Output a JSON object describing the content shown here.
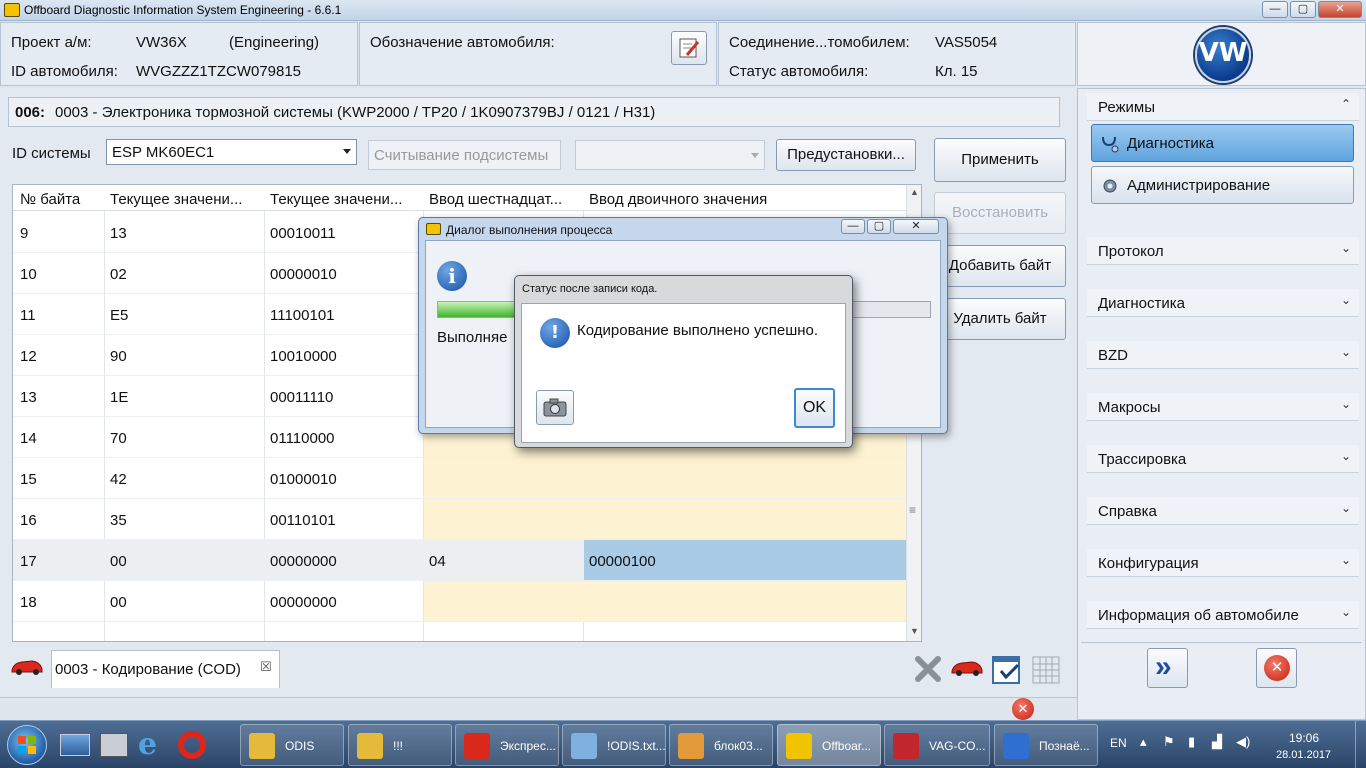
{
  "window": {
    "title": "Offboard Diagnostic Information System Engineering - 6.6.1",
    "minimize_glyph": "—",
    "maximize_glyph": "▢",
    "close_glyph": "✕"
  },
  "header": {
    "project_label": "Проект а/м:",
    "project_value": "VW36X",
    "project_mode": "(Engineering)",
    "vehicle_id_label": "ID автомобиля:",
    "vehicle_id_value": "WVGZZZ1TZCW079815",
    "vehicle_designation_label": "Обозначение автомобиля:",
    "connection_label": "Соединение...томобилем:",
    "connection_value": "VAS5054",
    "vehicle_status_label": "Статус автомобиля:",
    "vehicle_status_value": "Кл. 15",
    "brand_logo_text": "VW"
  },
  "ecu": {
    "number": "006:",
    "description": "0003 - Электроника тормозной системы  (KWP2000 / TP20 / 1K0907379BJ / 0121 / H31)"
  },
  "controls": {
    "system_id_label": "ID системы",
    "system_id_value": "ESP MK60EC1",
    "subsystem_button": "Считывание подсистемы",
    "subsystem_select_value": "",
    "presets_button": "Предустановки...",
    "apply_button": "Применить",
    "restore_button": "Восстановить",
    "add_byte_button": "Добавить байт",
    "delete_byte_button": "Удалить байт"
  },
  "table": {
    "columns": [
      "№ байта",
      "Текущее значени...",
      "Текущее значени...",
      "Ввод шестнадцат...",
      "Ввод двоичного значения"
    ],
    "rows": [
      {
        "byte": "9",
        "hex": "13",
        "bin": "00010011",
        "in_hex": "",
        "in_bin": ""
      },
      {
        "byte": "10",
        "hex": "02",
        "bin": "00000010",
        "in_hex": "",
        "in_bin": ""
      },
      {
        "byte": "11",
        "hex": "E5",
        "bin": "11100101",
        "in_hex": "",
        "in_bin": ""
      },
      {
        "byte": "12",
        "hex": "90",
        "bin": "10010000",
        "in_hex": "",
        "in_bin": ""
      },
      {
        "byte": "13",
        "hex": "1E",
        "bin": "00011110",
        "in_hex": "",
        "in_bin": ""
      },
      {
        "byte": "14",
        "hex": "70",
        "bin": "01110000",
        "in_hex": "",
        "in_bin": ""
      },
      {
        "byte": "15",
        "hex": "42",
        "bin": "01000010",
        "in_hex": "",
        "in_bin": ""
      },
      {
        "byte": "16",
        "hex": "35",
        "bin": "00110101",
        "in_hex": "",
        "in_bin": ""
      },
      {
        "byte": "17",
        "hex": "00",
        "bin": "00000000",
        "in_hex": "04",
        "in_bin": "00000100"
      },
      {
        "byte": "18",
        "hex": "00",
        "bin": "00000000",
        "in_hex": "",
        "in_bin": ""
      }
    ],
    "scroll_up_glyph": "▲",
    "scroll_down_glyph": "▼",
    "scroll_grip_glyph": "≡"
  },
  "bottom_tab": {
    "label": "0003 - Кодирование (COD)",
    "close_glyph": "☒"
  },
  "sidebar": {
    "modes_label": "Режимы",
    "mode_diagnostics": "Диагностика",
    "mode_admin": "Администрирование",
    "sections": [
      "Протокол",
      "Диагностика",
      "BZD",
      "Макросы",
      "Трассировка",
      "Справка",
      "Конфигурация",
      "Информация об автомобиле"
    ],
    "chevron_up": "⌃",
    "chevron_down": "⌄",
    "forward_glyph": "»",
    "exit_glyph": "✕"
  },
  "process_dialog": {
    "title": "Диалог выполнения процесса",
    "progress": 0.35,
    "status_text": "Выполняе",
    "info_glyph": "i"
  },
  "status_dialog": {
    "title": "Статус после записи кода.",
    "message": "Кодирование выполнено успешно.",
    "ok_button": "OK",
    "exclaim_glyph": "!"
  },
  "taskbar": {
    "items": [
      "ODIS",
      "!!!",
      "Экспрес...",
      "!ODIS.txt...",
      "блок03...",
      "Offboar...",
      "VAG-CO...",
      "Познаё..."
    ],
    "lang": "EN",
    "time": "19:06",
    "date": "28.01.2017"
  },
  "colors": {
    "accent": "#3b6fb6",
    "selected_row": "#a9cbe6",
    "input_cell": "#fdf2d2"
  }
}
